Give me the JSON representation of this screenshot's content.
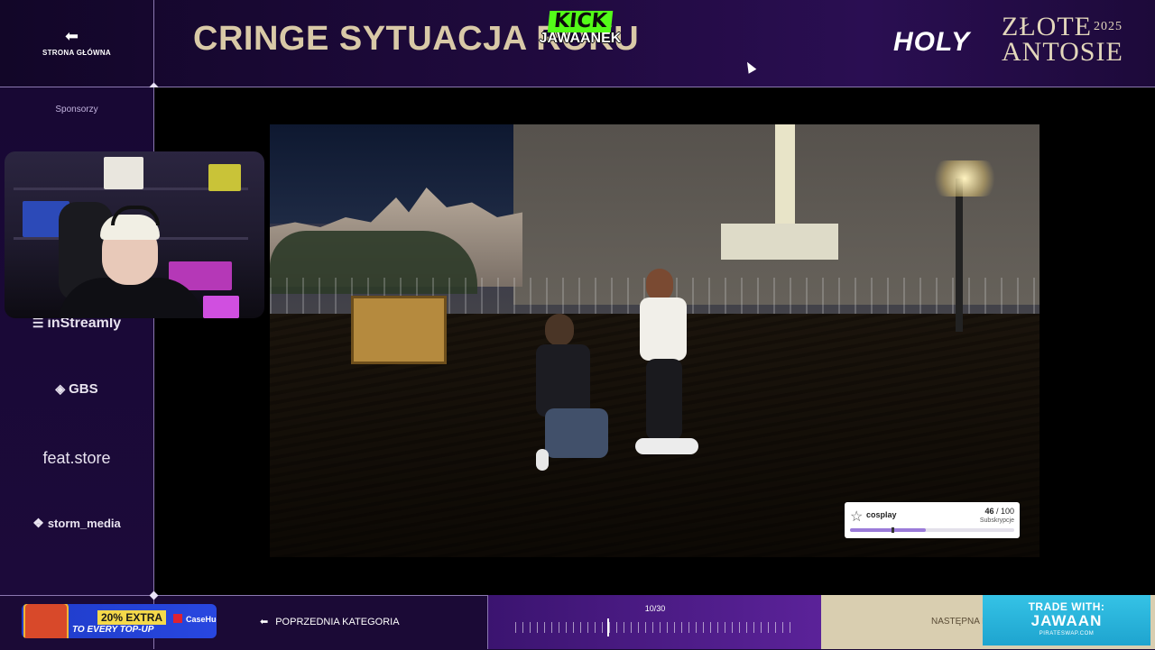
{
  "header": {
    "home_label": "STRONA GŁÓWNA",
    "title": "CRINGE SYTUACJA ROKU",
    "kick_logo": "KICK",
    "channel_name": "JAWAANEK",
    "holy_logo": "HOLY",
    "award_line1": "ZŁOTE",
    "award_year": "2025",
    "award_line2": "ANTOSIE"
  },
  "sidebar": {
    "sponsors_label": "Sponsorzy",
    "sponsors": [
      {
        "name": "inStreamly",
        "icon": "instreamly-icon"
      },
      {
        "name": "GBS",
        "icon": "gbs-icon"
      },
      {
        "name": "feat.store",
        "icon": "none"
      },
      {
        "name": "storm_media",
        "icon": "storm-icon"
      }
    ]
  },
  "subgoal": {
    "name": "cosplay",
    "current": "46",
    "target": "/ 100",
    "label": "Subskrypcje",
    "progress": 0.46
  },
  "footer": {
    "promo": {
      "extra": "20% EXTRA",
      "topup": "TO EVERY TOP-UP",
      "brand": "CaseHug"
    },
    "prev_label": "POPRZEDNIA KATEGORIA",
    "progress_text": "10/30",
    "progress_current": 10,
    "progress_total": 30,
    "next_label": "NASTĘPNA K",
    "trade": {
      "line1": "TRADE WITH:",
      "line2": "JAWAAN",
      "line3": "PIRATESWAP.COM"
    }
  },
  "colors": {
    "accent_purple": "#5b2299",
    "title_gold": "#d9c9a7",
    "kick_green": "#53fc18",
    "trade_blue": "#1ea4cf"
  }
}
